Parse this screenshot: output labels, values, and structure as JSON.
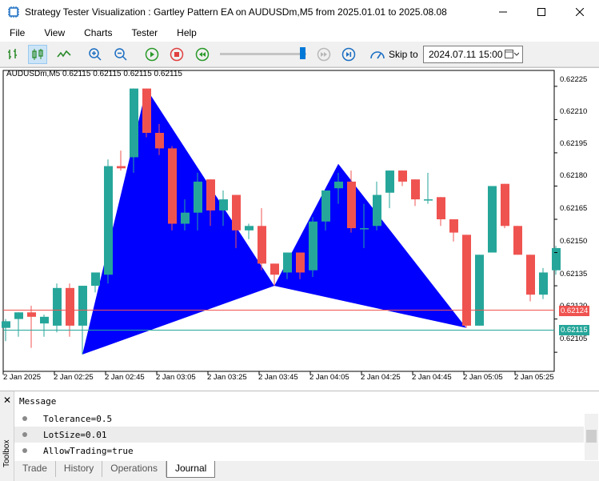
{
  "window": {
    "title": "Strategy Tester Visualization : Gartley Pattern EA on AUDUSDm,M5 from 2025.01.01 to 2025.08.08"
  },
  "menu": [
    "File",
    "View",
    "Charts",
    "Tester",
    "Help"
  ],
  "toolbar": {
    "skip_label": "Skip to",
    "skip_date": "2024.07.11 15:00",
    "slider_position": 0.95
  },
  "chart": {
    "symbol_info": "AUDUSDm,M5  0.62115 0.62115 0.62115 0.62115",
    "price_labels": [
      "0.62225",
      "0.62210",
      "0.62195",
      "0.62180",
      "0.62165",
      "0.62150",
      "0.62135",
      "0.62120",
      "0.62105"
    ],
    "time_labels": [
      "2 Jan 2025",
      "2 Jan 02:25",
      "2 Jan 02:45",
      "2 Jan 03:05",
      "2 Jan 03:25",
      "2 Jan 03:45",
      "2 Jan 04:05",
      "2 Jan 04:25",
      "2 Jan 04:45",
      "2 Jan 05:05",
      "2 Jan 05:25"
    ],
    "red_line_price": "0.62124",
    "green_line_price": "0.62115",
    "colors": {
      "bull": "#26a69a",
      "bear": "#ef5350",
      "pattern": "#0000ff",
      "red_line": "#ef5350",
      "green_line": "#26a69a"
    }
  },
  "chart_data": {
    "type": "candlestick",
    "price_range": [
      0.621,
      0.62232
    ],
    "candles": [
      {
        "o": 0.62116,
        "h": 0.6212,
        "l": 0.6211,
        "c": 0.62119
      },
      {
        "o": 0.6212,
        "h": 0.62123,
        "l": 0.62112,
        "c": 0.62123
      },
      {
        "o": 0.62123,
        "h": 0.62126,
        "l": 0.62107,
        "c": 0.62121
      },
      {
        "o": 0.62118,
        "h": 0.62122,
        "l": 0.62112,
        "c": 0.62121
      },
      {
        "o": 0.62117,
        "h": 0.62136,
        "l": 0.62114,
        "c": 0.62134
      },
      {
        "o": 0.62134,
        "h": 0.62136,
        "l": 0.62112,
        "c": 0.62117
      },
      {
        "o": 0.62117,
        "h": 0.62135,
        "l": 0.62104,
        "c": 0.62135
      },
      {
        "o": 0.62135,
        "h": 0.62141,
        "l": 0.62132,
        "c": 0.62141
      },
      {
        "o": 0.6214,
        "h": 0.62192,
        "l": 0.62136,
        "c": 0.62189
      },
      {
        "o": 0.62189,
        "h": 0.62196,
        "l": 0.62187,
        "c": 0.62188
      },
      {
        "o": 0.62193,
        "h": 0.62224,
        "l": 0.62186,
        "c": 0.62224
      },
      {
        "o": 0.62224,
        "h": 0.62224,
        "l": 0.62202,
        "c": 0.62204
      },
      {
        "o": 0.62204,
        "h": 0.62208,
        "l": 0.62194,
        "c": 0.62197
      },
      {
        "o": 0.62197,
        "h": 0.62198,
        "l": 0.6216,
        "c": 0.62163
      },
      {
        "o": 0.62163,
        "h": 0.62174,
        "l": 0.6216,
        "c": 0.62168
      },
      {
        "o": 0.62168,
        "h": 0.62186,
        "l": 0.6216,
        "c": 0.62182
      },
      {
        "o": 0.62183,
        "h": 0.62183,
        "l": 0.62162,
        "c": 0.62169
      },
      {
        "o": 0.62169,
        "h": 0.62178,
        "l": 0.62162,
        "c": 0.62174
      },
      {
        "o": 0.62176,
        "h": 0.62176,
        "l": 0.62152,
        "c": 0.6216
      },
      {
        "o": 0.6216,
        "h": 0.62163,
        "l": 0.62156,
        "c": 0.62162
      },
      {
        "o": 0.62162,
        "h": 0.6217,
        "l": 0.62142,
        "c": 0.62145
      },
      {
        "o": 0.62145,
        "h": 0.62145,
        "l": 0.62135,
        "c": 0.6214
      },
      {
        "o": 0.62141,
        "h": 0.6215,
        "l": 0.62138,
        "c": 0.6215
      },
      {
        "o": 0.6215,
        "h": 0.6215,
        "l": 0.62138,
        "c": 0.62141
      },
      {
        "o": 0.62142,
        "h": 0.62166,
        "l": 0.62139,
        "c": 0.62164
      },
      {
        "o": 0.62164,
        "h": 0.62178,
        "l": 0.6216,
        "c": 0.62178
      },
      {
        "o": 0.62179,
        "h": 0.62186,
        "l": 0.62172,
        "c": 0.62182
      },
      {
        "o": 0.62182,
        "h": 0.62187,
        "l": 0.62159,
        "c": 0.62161
      },
      {
        "o": 0.62161,
        "h": 0.62172,
        "l": 0.62152,
        "c": 0.62161
      },
      {
        "o": 0.62162,
        "h": 0.62182,
        "l": 0.6216,
        "c": 0.62176
      },
      {
        "o": 0.62177,
        "h": 0.62187,
        "l": 0.6217,
        "c": 0.62187
      },
      {
        "o": 0.62187,
        "h": 0.62187,
        "l": 0.6218,
        "c": 0.62182
      },
      {
        "o": 0.62183,
        "h": 0.62183,
        "l": 0.62171,
        "c": 0.62174
      },
      {
        "o": 0.62174,
        "h": 0.62186,
        "l": 0.62172,
        "c": 0.62174
      },
      {
        "o": 0.62175,
        "h": 0.62175,
        "l": 0.62162,
        "c": 0.62165
      },
      {
        "o": 0.62165,
        "h": 0.62165,
        "l": 0.62155,
        "c": 0.62159
      },
      {
        "o": 0.62158,
        "h": 0.62158,
        "l": 0.62116,
        "c": 0.62117
      },
      {
        "o": 0.62117,
        "h": 0.62149,
        "l": 0.62117,
        "c": 0.62149
      },
      {
        "o": 0.6215,
        "h": 0.6218,
        "l": 0.6215,
        "c": 0.6218
      },
      {
        "o": 0.62181,
        "h": 0.62181,
        "l": 0.62161,
        "c": 0.62162
      },
      {
        "o": 0.62162,
        "h": 0.62162,
        "l": 0.62149,
        "c": 0.62149
      },
      {
        "o": 0.62149,
        "h": 0.62149,
        "l": 0.62128,
        "c": 0.62131
      },
      {
        "o": 0.62131,
        "h": 0.62143,
        "l": 0.62129,
        "c": 0.62141
      },
      {
        "o": 0.62142,
        "h": 0.62153,
        "l": 0.6214,
        "c": 0.62152
      }
    ],
    "pattern_points": [
      {
        "i": 6,
        "p": 0.62104
      },
      {
        "i": 11,
        "p": 0.62224
      },
      {
        "i": 21,
        "p": 0.62135
      },
      {
        "i": 26,
        "p": 0.6219
      },
      {
        "i": 36,
        "p": 0.62116
      }
    ]
  },
  "panel": {
    "header": "Message",
    "messages": [
      "Tolerance=0.5",
      "LotSize=0.01",
      "AllowTrading=true"
    ],
    "tabs": [
      "Trade",
      "History",
      "Operations",
      "Journal"
    ],
    "active_tab": "Journal",
    "toolbox_label": "Toolbox"
  }
}
